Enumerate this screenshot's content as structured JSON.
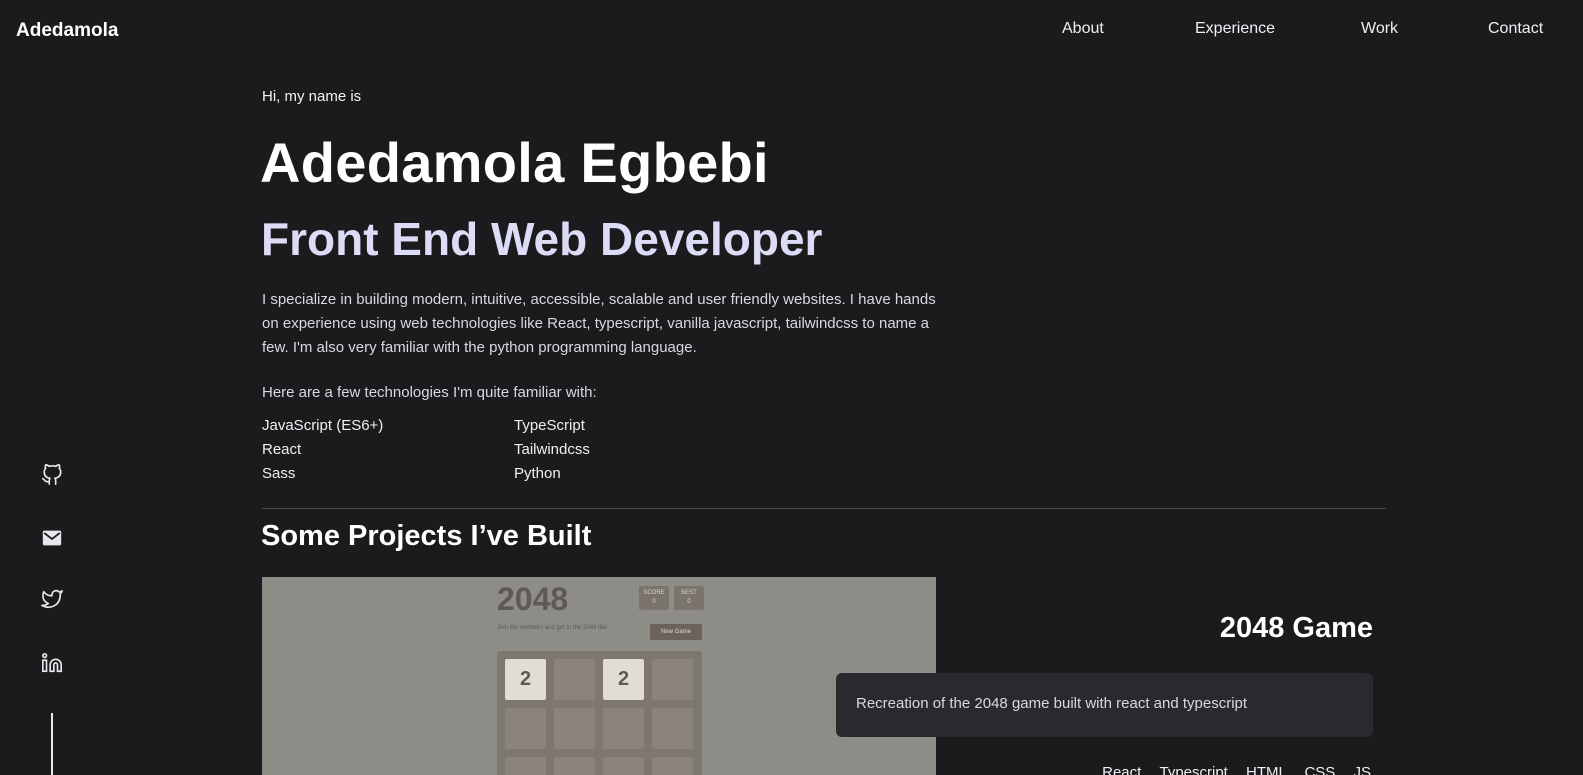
{
  "header": {
    "brand": "Adedamola",
    "nav": [
      "About",
      "Experience",
      "Work",
      "Contact"
    ]
  },
  "social": [
    "github-icon",
    "mail-icon",
    "twitter-icon",
    "linkedin-icon"
  ],
  "hero": {
    "greeting": "Hi, my name is",
    "name": "Adedamola Egbebi",
    "role": "Front End Web Developer",
    "bio": "I specialize in building modern, intuitive, accessible, scalable and user friendly websites. I have hands on experience using web technologies like React, typescript, vanilla javascript, tailwindcss to name a few. I'm also very familiar with the python programming language.",
    "tech_intro": "Here are a few technologies I'm quite familiar with:",
    "technologies": [
      "JavaScript (ES6+)",
      "TypeScript",
      "React",
      "Tailwindcss",
      "Sass",
      "Python"
    ]
  },
  "projects": {
    "heading": "Some Projects I’ve Built",
    "items": [
      {
        "name": "2048 Game",
        "description": "Recreation of the 2048 game built with react and typescript",
        "tags": [
          "React",
          "Typescript",
          "HTML",
          "CSS",
          "JS"
        ],
        "preview": {
          "title": "2048",
          "score_label": "SCORE",
          "score": "0",
          "best_label": "BEST",
          "best": "0",
          "subtitle": "Join the numbers and get to the 2048 tile!",
          "button": "New Game",
          "tiles": [
            "2",
            "",
            "2",
            ""
          ]
        }
      }
    ]
  },
  "colors": {
    "background": "#1b1b1d",
    "accent_role": "#dcdcf7",
    "card": "#2a2a2e"
  }
}
